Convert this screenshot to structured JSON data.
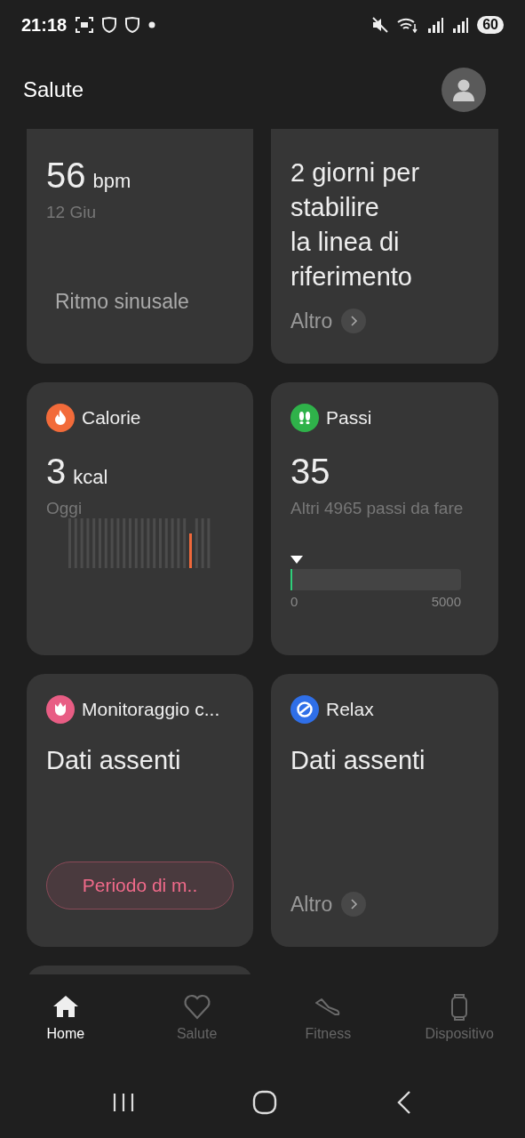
{
  "status_bar": {
    "time": "21:18",
    "battery": "60"
  },
  "header": {
    "title": "Salute"
  },
  "cards": [
    {
      "kind": "reading",
      "value": "56",
      "unit": "bpm",
      "sub": "12 Giu",
      "footer": {
        "kind": "note",
        "text": "Ritmo sinusale"
      }
    },
    {
      "kind": "message",
      "message": "2 giorni per stabilire\nla linea di riferimento",
      "footer": {
        "kind": "link",
        "text": "Altro"
      }
    },
    {
      "kind": "reading",
      "color": "#f26b3a",
      "title": "Calorie",
      "value": "3",
      "unit": "kcal",
      "sub": "Oggi",
      "footer": {
        "kind": "bars"
      }
    },
    {
      "kind": "reading",
      "color": "#2fb24a",
      "title": "Passi",
      "value": "35",
      "sub": "Altri 4965 passi da fare",
      "footer": {
        "kind": "progress",
        "level": 0.007,
        "min": "0",
        "max": "5000"
      }
    },
    {
      "kind": "message",
      "color": "#e85d84",
      "title": "Monitoraggio c...",
      "message": "Dati assenti",
      "footer": {
        "kind": "button",
        "text": "Periodo di m.."
      }
    },
    {
      "kind": "message",
      "color": "#2f6fe8",
      "title": "Relax",
      "message": "Dati assenti",
      "footer": {
        "kind": "link",
        "text": "Altro"
      }
    }
  ],
  "tabs": [
    {
      "label": "Home",
      "selected": true
    },
    {
      "label": "Salute",
      "selected": false
    },
    {
      "label": "Fitness",
      "selected": false
    },
    {
      "label": "Dispositivo",
      "selected": false
    }
  ]
}
